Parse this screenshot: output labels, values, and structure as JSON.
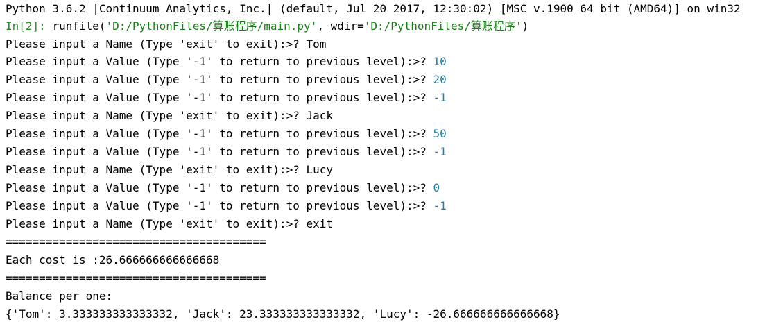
{
  "colors": {
    "background": "#ffffff",
    "text": "#000000",
    "prompt": "#2e8b2e",
    "string": "#1a7f1a",
    "number": "#1f7fa6"
  },
  "console": {
    "banner": "Python 3.6.2 |Continuum Analytics, Inc.| (default, Jul 20 2017, 12:30:02) [MSC v.1900 64 bit (AMD64)] on win32",
    "run": {
      "prompt": "In[2]: ",
      "func_open": "runfile(",
      "path": "'D:/PythonFiles/算账程序/main.py'",
      "sep": ", wdir=",
      "wdir": "'D:/PythonFiles/算账程序'",
      "func_close": ")"
    },
    "session": [
      {
        "prompt": "Please input a Name (Type 'exit' to exit):>? ",
        "input": "Tom",
        "kind": "text"
      },
      {
        "prompt": "Please input a Value (Type '-1' to return to previous level):>? ",
        "input": "10",
        "kind": "num"
      },
      {
        "prompt": "Please input a Value (Type '-1' to return to previous level):>? ",
        "input": "20",
        "kind": "num"
      },
      {
        "prompt": "Please input a Value (Type '-1' to return to previous level):>? ",
        "input": "-1",
        "kind": "num"
      },
      {
        "prompt": "Please input a Name (Type 'exit' to exit):>? ",
        "input": "Jack",
        "kind": "text"
      },
      {
        "prompt": "Please input a Value (Type '-1' to return to previous level):>? ",
        "input": "50",
        "kind": "num"
      },
      {
        "prompt": "Please input a Value (Type '-1' to return to previous level):>? ",
        "input": "-1",
        "kind": "num"
      },
      {
        "prompt": "Please input a Name (Type 'exit' to exit):>? ",
        "input": "Lucy",
        "kind": "text"
      },
      {
        "prompt": "Please input a Value (Type '-1' to return to previous level):>? ",
        "input": "0",
        "kind": "num"
      },
      {
        "prompt": "Please input a Value (Type '-1' to return to previous level):>? ",
        "input": "-1",
        "kind": "num"
      },
      {
        "prompt": "Please input a Name (Type 'exit' to exit):>? ",
        "input": "exit",
        "kind": "text"
      }
    ],
    "separator_1": "=======================================",
    "each_cost": "Each cost is :26.666666666666668",
    "separator_2": "=======================================",
    "balance_label": "Balance per one:",
    "balance_dict": "{'Tom': 3.333333333333332, 'Jack': 23.333333333333332, 'Lucy': -26.666666666666668}"
  }
}
